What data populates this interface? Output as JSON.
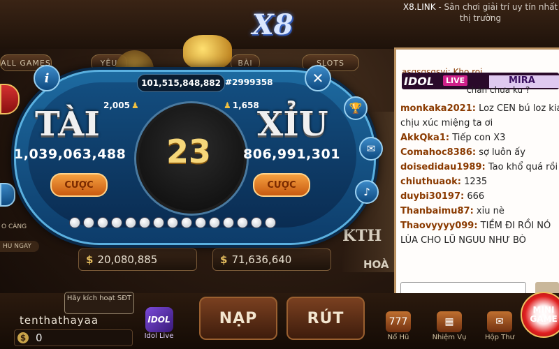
{
  "header": {
    "logo": "X8",
    "site_brand": "X8.LINK",
    "site_tagline": " - Sân chơi giải trí uy tín nhất thị trường",
    "nav_tabs": [
      "ALL GAMES",
      "YÊU",
      "BÀI",
      "SLOTS"
    ]
  },
  "game": {
    "total_pot": "101,515,848,882",
    "session_id": "#2999358",
    "dice_sum": "23",
    "tai": {
      "label": "TÀI",
      "players": "2,005",
      "bet_total": "1,039,063,488",
      "bet_button": "CƯỢC"
    },
    "xiu": {
      "label": "XỈU",
      "players": "1,658",
      "bet_total": "806,991,301",
      "bet_button": "CƯỢC"
    },
    "history_count": 15,
    "info_icon": "i",
    "close_icon": "✕"
  },
  "lobby": {
    "jackpots": [
      "20,080,885",
      "71,636,640"
    ],
    "currency_symbol": "$",
    "left_label": "HU NGAY",
    "left_sub": "O CÀNG",
    "bg_game_title": "KTH",
    "bg_game_sub": "HOÀ"
  },
  "user": {
    "activate_text": "Hãy kích hoạt SĐT",
    "username": "tenthathayaa",
    "balance": "0"
  },
  "bottom": {
    "idol_app": "Idol Live",
    "idol_icon_text": "IDOL",
    "deposit": "NẠP",
    "withdraw": "RÚT",
    "icons": [
      {
        "label": "Nổ Hũ",
        "icon": "777"
      },
      {
        "label": "Nhiệm Vụ",
        "icon": "▦"
      },
      {
        "label": "Hộp Thư",
        "icon": "✉"
      }
    ],
    "minigame": "MINI GAME"
  },
  "chat": {
    "idol_label": "IDOL",
    "live_label": "LIVE",
    "host": "MIRA",
    "partial_user": "asgsgsgsyi: Kho roi",
    "partial_text": "chán chưa ku ?",
    "messages": [
      {
        "user": "monkaka2021:",
        "text": " Loz CEN bú loz kia chịu xúc miệng ta ơi"
      },
      {
        "user": "AkkQka1:",
        "text": " Tiếp con X3"
      },
      {
        "user": "Comahoc8386:",
        "text": " sợ luôn ấy"
      },
      {
        "user": "doisedidau1989:",
        "text": " Tao khổ quá rồi"
      },
      {
        "user": "chiuthuaok:",
        "text": " 1235"
      },
      {
        "user": "duybi30197:",
        "text": " 666"
      },
      {
        "user": "Thanbaimu87:",
        "text": " xỉu nè"
      },
      {
        "user": "Thaovyyyy099:",
        "text": " TIỀM ĐI RỒI NÓ LÙA CHO LŨ NGUU NHƯ BÒ"
      }
    ]
  },
  "colors": {
    "panel_blue": "#1d6aa0",
    "bet_orange": "#f5a040",
    "dice_gold": "#f6d77a",
    "chat_user": "#8a3a00"
  }
}
